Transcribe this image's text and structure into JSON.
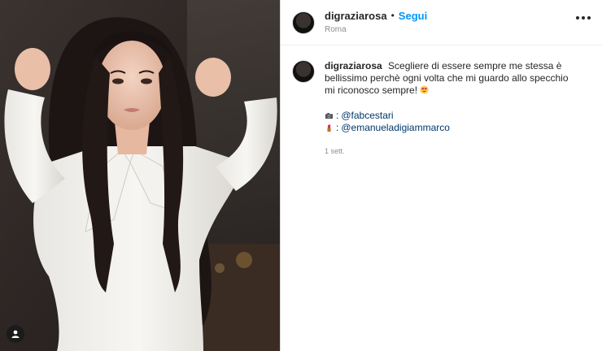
{
  "post": {
    "username": "digraziarosa",
    "separator": "•",
    "follow_label": "Segui",
    "location": "Roma",
    "more_icon": "more-horizontal-icon",
    "tag_icon": "user-tag-icon",
    "caption": {
      "username": "digraziarosa",
      "text": "Scegliere di essere sempre me stessa è bellissimo perchè ogni volta che mi guardo allo specchio mi riconosco sempre!",
      "emoji": "heart-eyes-emoji",
      "credits": [
        {
          "icon": "camera-emoji",
          "separator": ":",
          "handle": "@fabcestari"
        },
        {
          "icon": "lipstick-emoji",
          "separator": ":",
          "handle": "@emanueladigiammarco"
        }
      ],
      "time": "1 sett."
    }
  },
  "colors": {
    "accent": "#0095f6",
    "mention": "#00376b",
    "muted": "#8e8e8e",
    "text": "#262626",
    "border": "#dbdbdb"
  }
}
